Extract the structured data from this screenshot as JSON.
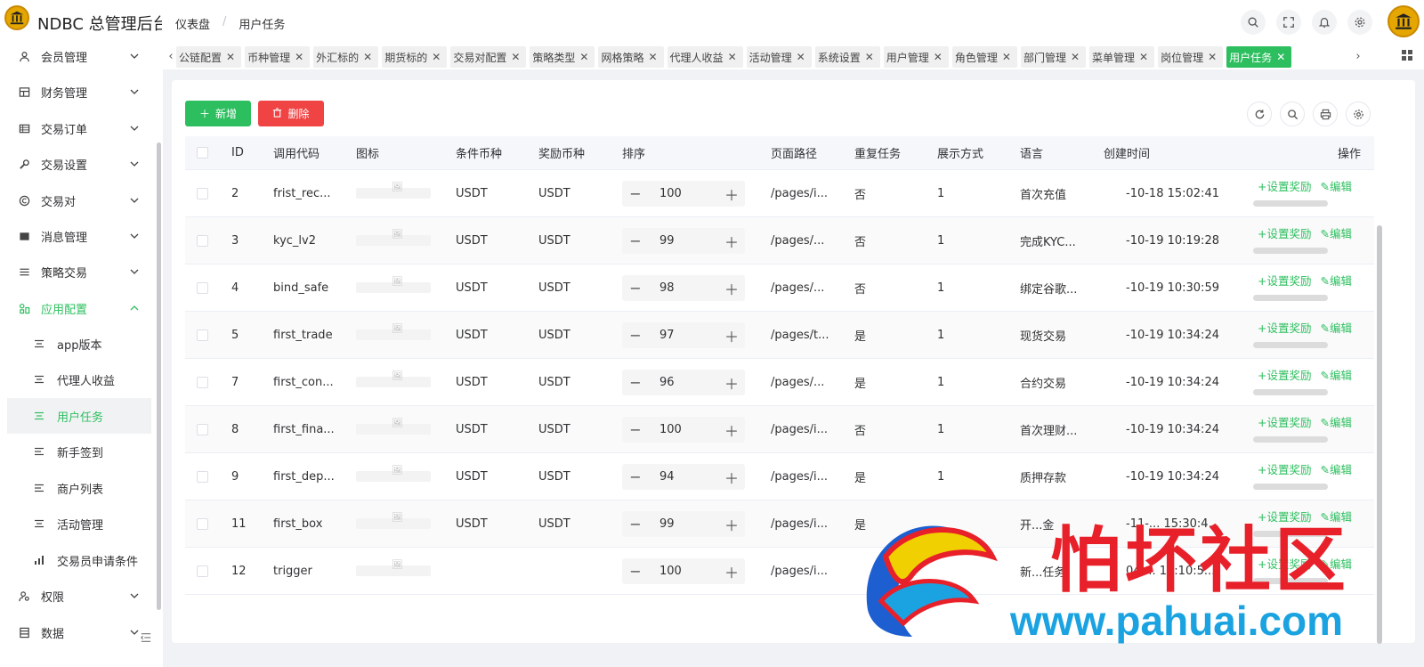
{
  "app": {
    "title": "NDBC 总管理后台"
  },
  "breadcrumb": {
    "home": "仪表盘",
    "sep": "/",
    "current": "用户任务"
  },
  "sidebar": {
    "items": [
      {
        "label": "会员管理",
        "icon": "user-icon"
      },
      {
        "label": "财务管理",
        "icon": "wallet-icon"
      },
      {
        "label": "交易订单",
        "icon": "list-icon"
      },
      {
        "label": "交易设置",
        "icon": "wrench-icon"
      },
      {
        "label": "交易对",
        "icon": "copyright-icon"
      },
      {
        "label": "消息管理",
        "icon": "message-icon"
      },
      {
        "label": "策略交易",
        "icon": "menu-icon"
      },
      {
        "label": "应用配置",
        "icon": "apps-icon"
      }
    ],
    "sub_items": [
      {
        "label": "app版本"
      },
      {
        "label": "代理人收益"
      },
      {
        "label": "用户任务"
      },
      {
        "label": "新手签到"
      },
      {
        "label": "商户列表"
      },
      {
        "label": "活动管理"
      },
      {
        "label": "交易员申请条件"
      }
    ],
    "tail_items": [
      {
        "label": "权限",
        "icon": "permission-icon"
      },
      {
        "label": "数据",
        "icon": "database-icon"
      }
    ]
  },
  "tags": [
    "公链配置",
    "币种管理",
    "外汇标的",
    "期货标的",
    "交易对配置",
    "策略类型",
    "网格策略",
    "代理人收益",
    "活动管理",
    "系统设置",
    "用户管理",
    "角色管理",
    "部门管理",
    "菜单管理",
    "岗位管理",
    "用户任务"
  ],
  "toolbar": {
    "add_label": "新增",
    "delete_label": "删除"
  },
  "table": {
    "headers": {
      "id": "ID",
      "code": "调用代码",
      "icon": "图标",
      "cond": "条件币种",
      "reward": "奖励币种",
      "sort": "排序",
      "path": "页面路径",
      "repeat": "重复任务",
      "display": "展示方式",
      "lang": "语言",
      "created": "创建时间",
      "ops": "操作"
    },
    "op_reward": "+设置奖励",
    "op_edit": "✎编辑",
    "rows": [
      {
        "id": "2",
        "code": "frist_rec...",
        "cond": "USDT",
        "reward": "USDT",
        "sort": "100",
        "path": "/pages/i...",
        "repeat": "否",
        "display": "1",
        "lang": "首次充值",
        "created": "-10-18 15:02:41"
      },
      {
        "id": "3",
        "code": "kyc_lv2",
        "cond": "USDT",
        "reward": "USDT",
        "sort": "99",
        "path": "/pages/...",
        "repeat": "否",
        "display": "1",
        "lang": "完成KYC...",
        "created": "-10-19 10:19:28"
      },
      {
        "id": "4",
        "code": "bind_safe",
        "cond": "USDT",
        "reward": "USDT",
        "sort": "98",
        "path": "/pages/...",
        "repeat": "否",
        "display": "1",
        "lang": "绑定谷歌...",
        "created": "-10-19 10:30:59"
      },
      {
        "id": "5",
        "code": "first_trade",
        "cond": "USDT",
        "reward": "USDT",
        "sort": "97",
        "path": "/pages/t...",
        "repeat": "是",
        "display": "1",
        "lang": "现货交易",
        "created": "-10-19 10:34:24"
      },
      {
        "id": "7",
        "code": "first_con...",
        "cond": "USDT",
        "reward": "USDT",
        "sort": "96",
        "path": "/pages/...",
        "repeat": "是",
        "display": "1",
        "lang": "合约交易",
        "created": "-10-19 10:34:24"
      },
      {
        "id": "8",
        "code": "first_fina...",
        "cond": "USDT",
        "reward": "USDT",
        "sort": "100",
        "path": "/pages/i...",
        "repeat": "否",
        "display": "1",
        "lang": "首次理财...",
        "created": "-10-19 10:34:24"
      },
      {
        "id": "9",
        "code": "first_dep...",
        "cond": "USDT",
        "reward": "USDT",
        "sort": "94",
        "path": "/pages/i...",
        "repeat": "是",
        "display": "1",
        "lang": "质押存款",
        "created": "-10-19 10:34:24"
      },
      {
        "id": "11",
        "code": "first_box",
        "cond": "USDT",
        "reward": "USDT",
        "sort": "99",
        "path": "/pages/i...",
        "repeat": "是",
        "display": "",
        "lang": "开...金",
        "created": "-11-... 15:30:4..."
      },
      {
        "id": "12",
        "code": "trigger",
        "cond": "",
        "reward": "",
        "sort": "100",
        "path": "/pages/i...",
        "repeat": "",
        "display": "",
        "lang": "新...任务",
        "created": "04-... 16:10:5..."
      }
    ]
  },
  "watermark": {
    "title": "怕坏社区",
    "url": "www.pahuai.com"
  },
  "colors": {
    "primary": "#2dbf5f",
    "danger": "#f04444"
  }
}
